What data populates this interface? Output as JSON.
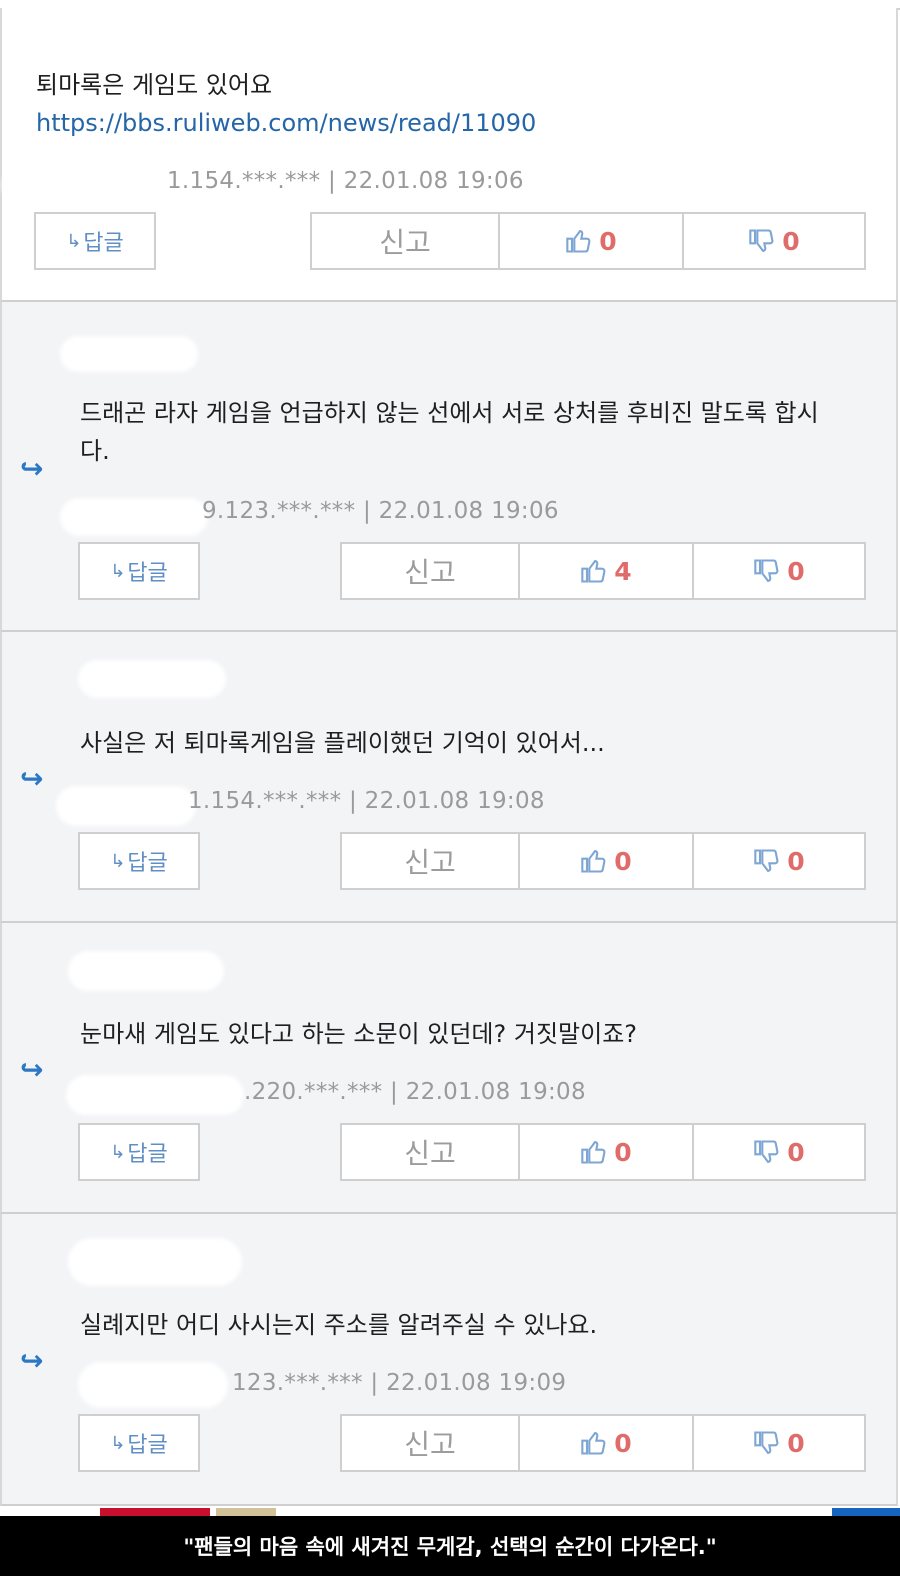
{
  "comments": [
    {
      "lines": [
        "퇴마록은 게임도 있어요"
      ],
      "link": "https://bbs.ruliweb.com/news/read/11090",
      "meta": "1.154.***.*** | 22.01.08 19:06",
      "reply_label": "답글",
      "report_label": "신고",
      "up": "0",
      "down": "0"
    },
    {
      "lines": [
        "드래곤 라자 게임을 언급하지 않는 선에서 서로 상처를 후비진 말도록 합시",
        "다."
      ],
      "meta": "9.123.***.*** | 22.01.08 19:06",
      "reply_label": "답글",
      "report_label": "신고",
      "up": "4",
      "down": "0"
    },
    {
      "lines": [
        "사실은 저 퇴마록게임을 플레이했던 기억이 있어서..."
      ],
      "meta": "1.154.***.*** | 22.01.08 19:08",
      "reply_label": "답글",
      "report_label": "신고",
      "up": "0",
      "down": "0"
    },
    {
      "lines": [
        "눈마새 게임도 있다고 하는 소문이 있던데? 거짓말이죠?"
      ],
      "meta": ".220.***.*** | 22.01.08 19:08",
      "reply_label": "답글",
      "report_label": "신고",
      "up": "0",
      "down": "0"
    },
    {
      "lines": [
        "실례지만 어디 사시는지 주소를 알려주실 수 있나요."
      ],
      "meta": "123.***.*** | 22.01.08 19:09",
      "reply_label": "답글",
      "report_label": "신고",
      "up": "0",
      "down": "0"
    }
  ],
  "footer_caption": "\"팬들의 마음 속에 새겨진 무게감, 선택의 순간이 다가온다.\"",
  "colors": {
    "link": "#2466a8",
    "vote": "#e06b6b",
    "reply_arrow": "#2c78c4",
    "reply_bg": "#f3f4f6"
  }
}
